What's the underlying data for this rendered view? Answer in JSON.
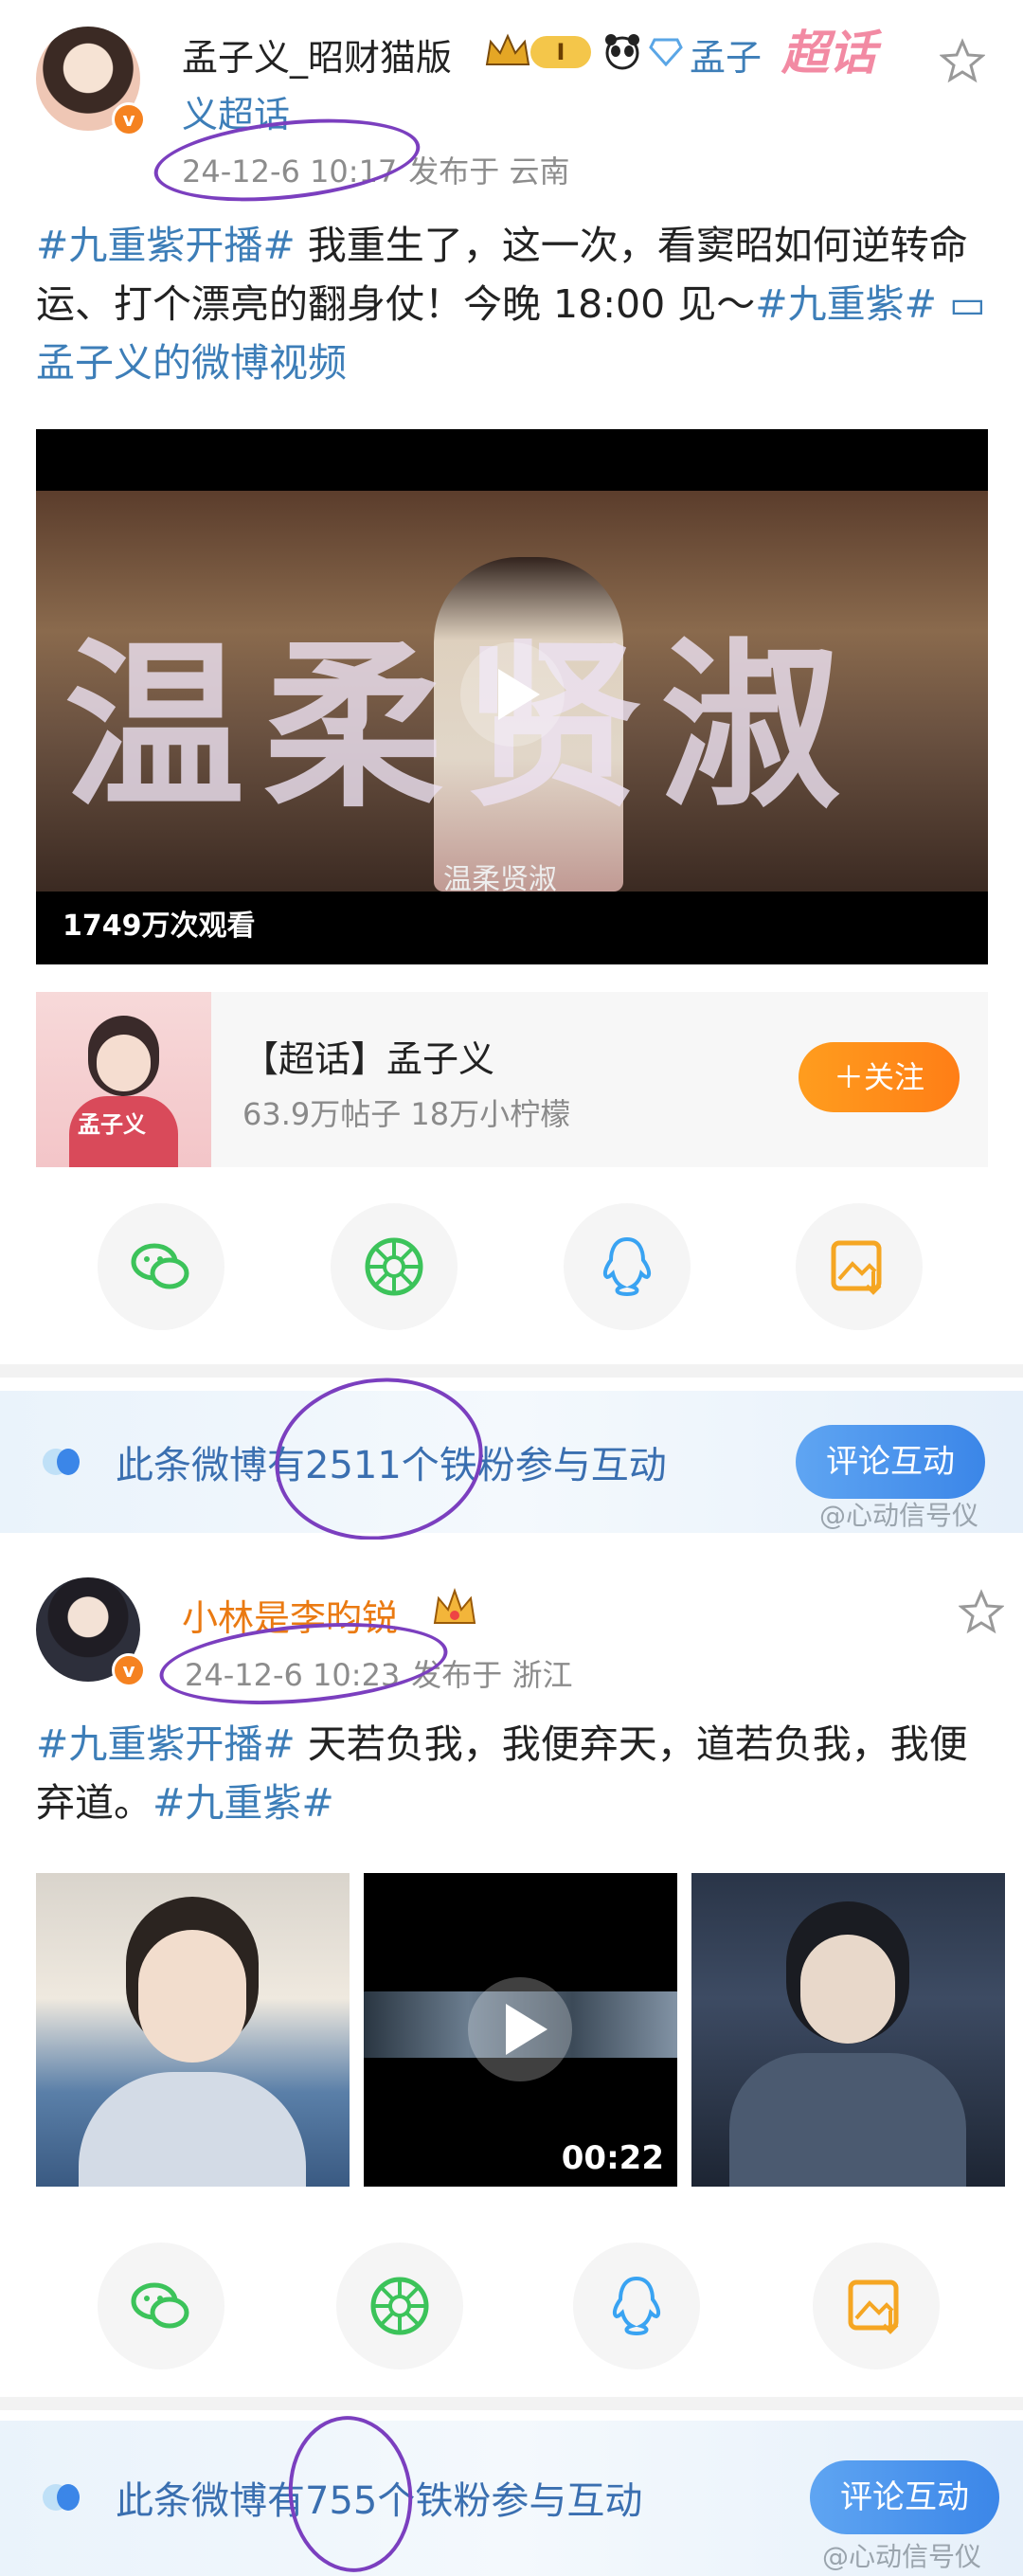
{
  "post1": {
    "username": "孟子义_昭财猫版",
    "badge_level": "I",
    "supertopic_link_1": "孟子",
    "supertopic_link_2": "义超话",
    "supertopic_tag": "超话",
    "verified_mark": "v",
    "time": "24-12-6 10:17",
    "location": "发布于 云南",
    "text_parts": {
      "topic1": "#九重紫开播#",
      "body": " 我重生了，这一次，看窦昭如何逆转命运、打个漂亮的翻身仗！今晚 18:00 见～",
      "topic2": "#九重紫#",
      "video_link": " 孟子义的微博视频"
    },
    "video": {
      "overlay_title": "温柔贤淑",
      "subtitle": "温柔贤淑",
      "views": "1749万次观看"
    },
    "supertopic_card": {
      "title": "【超话】孟子义",
      "stats": "63.9万帖子  18万小柠檬",
      "follow_label": "＋关注",
      "thumb_label": "孟子义"
    },
    "share_icons": [
      "wechat-icon",
      "moments-icon",
      "qq-icon",
      "save-image-icon"
    ]
  },
  "fanbar1": {
    "text": "此条微博有2511个铁粉参与互动",
    "button": "评论互动",
    "watermark": "@心动信号仪"
  },
  "post2": {
    "username": "小林是李昀锐",
    "verified_mark": "v",
    "time": "24-12-6 10:23",
    "location": "发布于 浙江",
    "text_parts": {
      "topic1": "#九重紫开播#",
      "body": " 天若负我，我便弃天，道若负我，我便弃道。",
      "topic2": "#九重紫#"
    },
    "images": [
      {
        "kind": "portrait"
      },
      {
        "kind": "video",
        "duration": "00:22"
      },
      {
        "kind": "poster"
      }
    ],
    "share_icons": [
      "wechat-icon",
      "moments-icon",
      "qq-icon",
      "save-image-icon"
    ]
  },
  "fanbar2": {
    "text": "此条微博有755个铁粉参与互动",
    "button": "评论互动",
    "watermark": "@心动信号仪"
  },
  "colors": {
    "topic_blue": "#3d7eb8",
    "follow_orange": "#ff8a1a",
    "button_blue": "#3b86e8",
    "annotation_purple": "#7b3fbf",
    "name_orange": "#ea7a12"
  }
}
